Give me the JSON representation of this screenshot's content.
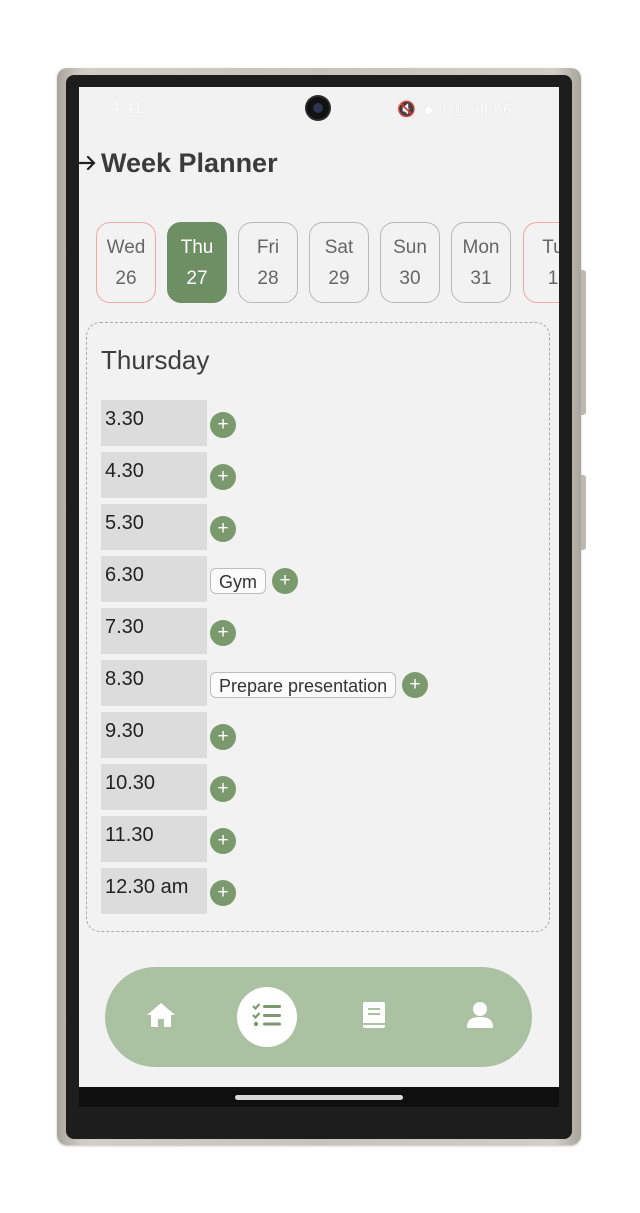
{
  "status": {
    "time": "4:41",
    "icons": "🔇 ◉ ⌇ ▥ ıll 66%",
    "battery": "66%"
  },
  "header": {
    "title": "Week Planner",
    "back_icon": "arrow-right-icon"
  },
  "days": [
    {
      "name": "Wed",
      "date": "26",
      "state": "today"
    },
    {
      "name": "Thu",
      "date": "27",
      "state": "selected"
    },
    {
      "name": "Fri",
      "date": "28",
      "state": "normal"
    },
    {
      "name": "Sat",
      "date": "29",
      "state": "normal"
    },
    {
      "name": "Sun",
      "date": "30",
      "state": "normal"
    },
    {
      "name": "Mon",
      "date": "31",
      "state": "normal"
    },
    {
      "name": "Tu",
      "date": "1",
      "state": "today"
    }
  ],
  "schedule": {
    "heading": "Thursday",
    "add_label": "+",
    "slots": [
      {
        "time": "3.30",
        "events": []
      },
      {
        "time": "4.30",
        "events": []
      },
      {
        "time": "5.30",
        "events": []
      },
      {
        "time": "6.30",
        "events": [
          "Gym"
        ]
      },
      {
        "time": "7.30",
        "events": []
      },
      {
        "time": "8.30",
        "events": [
          "Prepare presentation"
        ]
      },
      {
        "time": "9.30",
        "events": []
      },
      {
        "time": "10.30",
        "events": []
      },
      {
        "time": "11.30",
        "events": []
      },
      {
        "time": "12.30 am",
        "events": []
      }
    ]
  },
  "nav": {
    "items": [
      {
        "icon": "home-icon",
        "active": false
      },
      {
        "icon": "checklist-icon",
        "active": true
      },
      {
        "icon": "book-icon",
        "active": false
      },
      {
        "icon": "user-icon",
        "active": false
      }
    ]
  },
  "colors": {
    "accent": "#6e8f64",
    "add_button": "#7a9a6e",
    "nav_bg": "#aac2a1",
    "today_border": "#f2a7a0",
    "screen_bg": "#f2f2f2"
  }
}
